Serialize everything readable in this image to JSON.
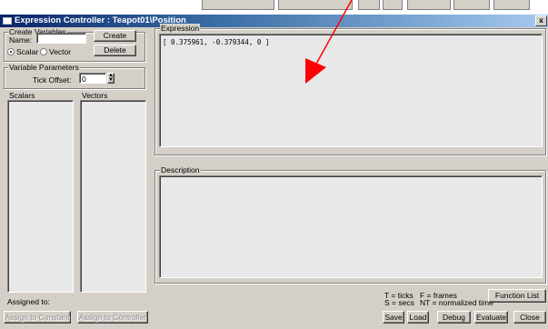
{
  "window": {
    "title": "Expression Controller : Teapot01\\Position",
    "close_glyph": "x"
  },
  "create_variables": {
    "legend": "Create Variables",
    "name_label": "Name:",
    "name_value": "",
    "create_label": "Create",
    "delete_label": "Delete",
    "scalar_label": "Scalar",
    "vector_label": "Vector",
    "selected_type": "Scalar"
  },
  "variable_parameters": {
    "legend": "Variable Parameters",
    "tick_offset_label": "Tick Offset:",
    "tick_offset_value": "0"
  },
  "lists": {
    "scalars_label": "Scalars",
    "vectors_label": "Vectors"
  },
  "assigned": {
    "label": "Assigned to:",
    "assign_constant": "Assign to Constant",
    "assign_controller": "Assign to Controller"
  },
  "expression": {
    "legend": "Expression",
    "text": "[ 0.375961, -0.379344, 0 ]"
  },
  "description": {
    "legend": "Description",
    "text": ""
  },
  "legend_help": {
    "ticks": "T = ticks",
    "secs": "S = secs",
    "frames": "F = frames",
    "normalized": "NT = normalized time"
  },
  "buttons": {
    "function_list": "Function List",
    "save": "Save",
    "load": "Load",
    "debug": "Debug",
    "evaluate": "Evaluate",
    "close": "Close"
  },
  "colors": {
    "annotation_arrow": "#ff0000",
    "titlebar_start": "#0a246a",
    "window_bg": "#d4d0c8"
  }
}
